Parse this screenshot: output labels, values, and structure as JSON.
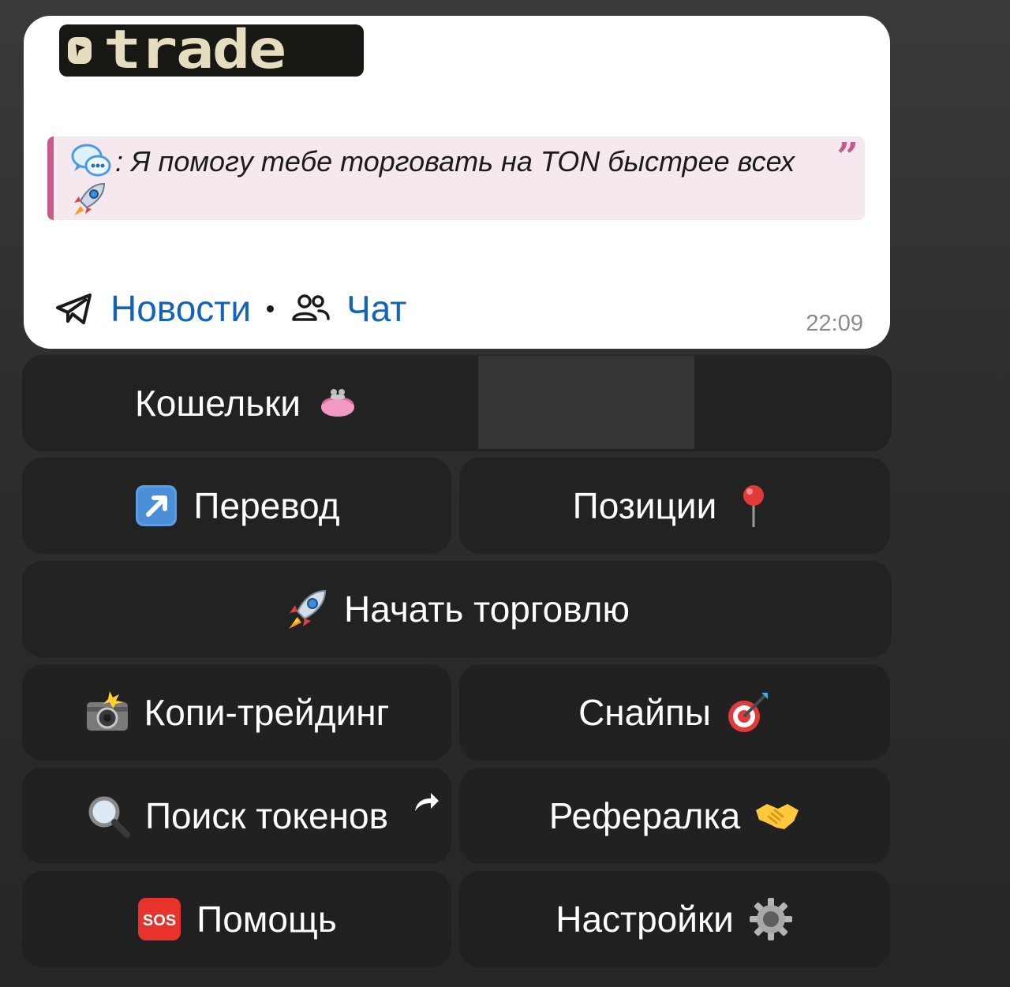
{
  "message": {
    "logo": {
      "text": "trade"
    },
    "quote": {
      "text": ": Я помогу тебе торговать на TON быстрее всех",
      "icon": "speech-bubbles-icon",
      "rocket_icon": "rocket-icon",
      "mark": "”"
    },
    "links": {
      "news_label": "Новости",
      "chat_label": "Чат"
    },
    "time": "22:09"
  },
  "keyboard": {
    "wallets": "Кошельки",
    "transfer": "Перевод",
    "positions": "Позиции",
    "start_trading": "Начать торговлю",
    "copy_trading": "Копи-трейдинг",
    "snipes": "Снайпы",
    "token_search": "Поиск токенов",
    "referral": "Рефералка",
    "help": "Помощь",
    "settings": "Настройки"
  },
  "colors": {
    "link": "#1463b8",
    "quote_accent": "#c85a8c",
    "quote_bg": "#f5e9ef",
    "button_bg": "#1e1e1e"
  }
}
